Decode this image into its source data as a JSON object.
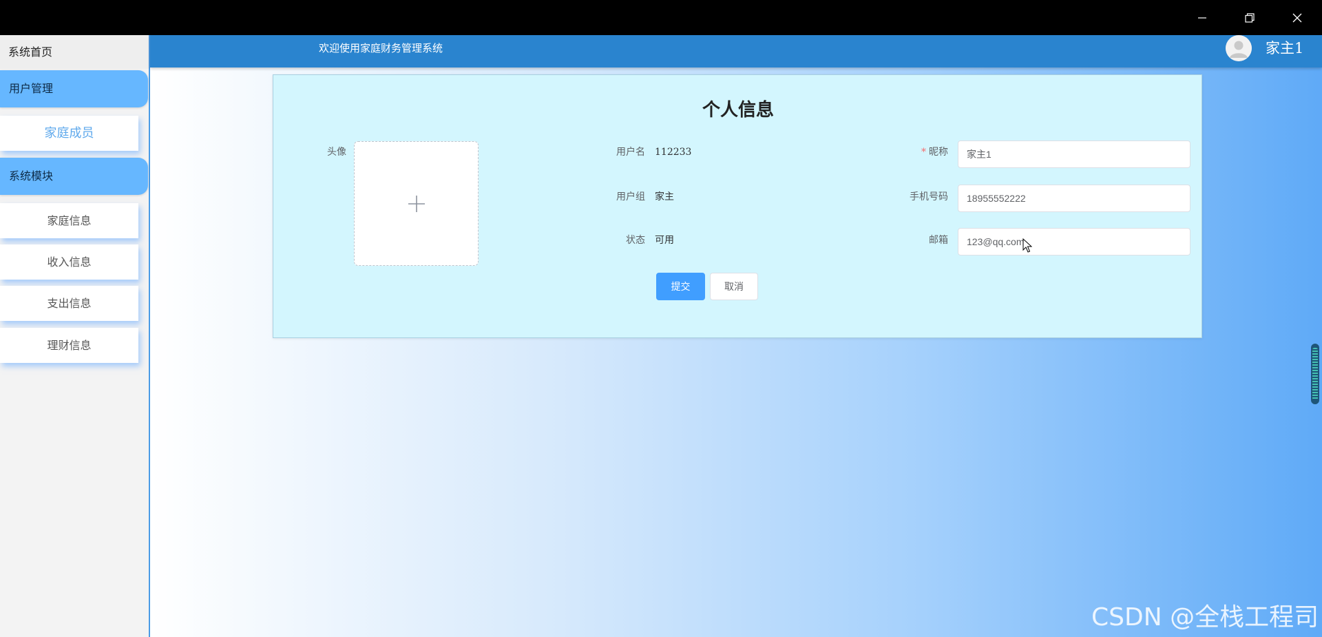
{
  "window": {
    "minimize_icon": "minimize-icon",
    "restore_icon": "restore-icon",
    "close_icon": "close-icon"
  },
  "sidebar": {
    "home": "系统首页",
    "groups": [
      {
        "label": "用户管理",
        "items": [
          {
            "label": "家庭成员",
            "active": true
          }
        ]
      },
      {
        "label": "系统模块",
        "items": [
          {
            "label": "家庭信息"
          },
          {
            "label": "收入信息"
          },
          {
            "label": "支出信息"
          },
          {
            "label": "理财信息"
          }
        ]
      }
    ]
  },
  "header": {
    "title": "欢迎使用家庭财务管理系统",
    "username": "家主1",
    "avatar_icon": "user-avatar-icon"
  },
  "form": {
    "title": "个人信息",
    "avatar_label": "头像",
    "upload_icon": "plus-icon",
    "username_label": "用户名",
    "username_value": "112233",
    "group_label": "用户组",
    "group_value": "家主",
    "status_label": "状态",
    "status_value": "可用",
    "nickname_label": "昵称",
    "nickname_required": "*",
    "nickname_value": "家主1",
    "phone_label": "手机号码",
    "phone_value": "18955552222",
    "email_label": "邮箱",
    "email_value": "123@qq.com",
    "submit_label": "提交",
    "cancel_label": "取消"
  },
  "watermark": "CSDN @全栈工程司",
  "colors": {
    "header_bg": "#2a84cf",
    "sidebar_group_bg": "#66b7ff",
    "card_bg": "#d3f6fe",
    "primary_button": "#409eff",
    "required_mark": "#f56c6c"
  }
}
